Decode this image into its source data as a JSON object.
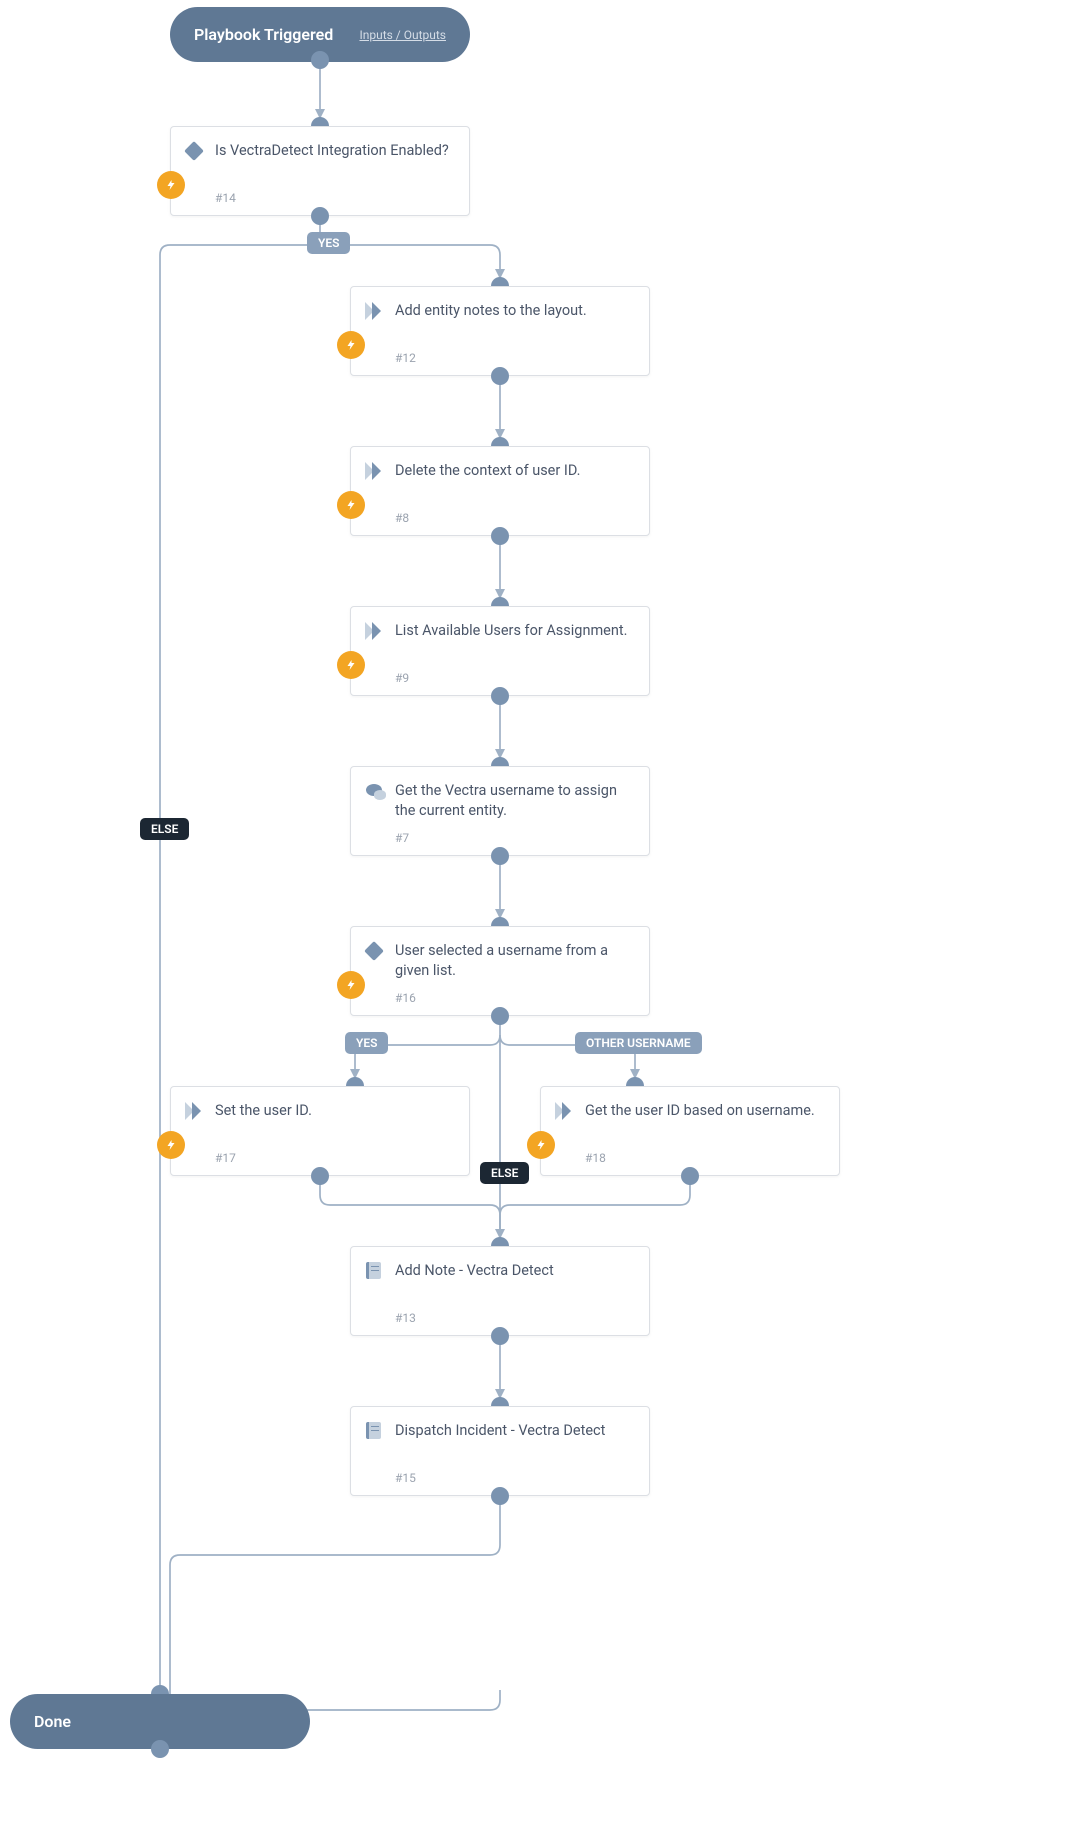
{
  "colors": {
    "pill": "#5f7894",
    "card_border": "#dcdfe4",
    "icon_primary": "#7a93b0",
    "icon_secondary": "#c5d1de",
    "bolt": "#f3a523",
    "branch_blue": "#8aa0ba",
    "branch_dark": "#1c2733",
    "connector": "#9fb1c5"
  },
  "start": {
    "title": "Playbook Triggered",
    "io_link": "Inputs / Outputs"
  },
  "end": {
    "title": "Done"
  },
  "branch_labels": {
    "yes": "YES",
    "else": "ELSE",
    "other_username": "OTHER USERNAME"
  },
  "cards": {
    "n14": {
      "title": "Is VectraDetect Integration Enabled?",
      "id": "#14",
      "icon": "diamond",
      "bolt": true
    },
    "n12": {
      "title": "Add entity notes to the layout.",
      "id": "#12",
      "icon": "chip",
      "bolt": true
    },
    "n8": {
      "title": "Delete the context of user ID.",
      "id": "#8",
      "icon": "chip",
      "bolt": true
    },
    "n9": {
      "title": "List Available Users for Assignment.",
      "id": "#9",
      "icon": "chip",
      "bolt": true
    },
    "n7": {
      "title": "Get the Vectra username to assign the current entity.",
      "id": "#7",
      "icon": "chat",
      "bolt": false
    },
    "n16": {
      "title": "User selected a username from a given list.",
      "id": "#16",
      "icon": "diamond",
      "bolt": true
    },
    "n17": {
      "title": "Set the user ID.",
      "id": "#17",
      "icon": "chip",
      "bolt": true
    },
    "n18": {
      "title": "Get the user ID based on username.",
      "id": "#18",
      "icon": "chip",
      "bolt": true
    },
    "n13": {
      "title": "Add Note - Vectra Detect",
      "id": "#13",
      "icon": "book",
      "bolt": false
    },
    "n15": {
      "title": "Dispatch Incident - Vectra Detect",
      "id": "#15",
      "icon": "book",
      "bolt": false
    }
  },
  "flow": {
    "start_out": [
      "n14"
    ],
    "n14": {
      "YES": "n12",
      "ELSE": "end"
    },
    "n12": {
      "next": "n8"
    },
    "n8": {
      "next": "n9"
    },
    "n9": {
      "next": "n7"
    },
    "n7": {
      "next": "n16"
    },
    "n16": {
      "YES": "n17",
      "OTHER USERNAME": "n18",
      "ELSE": "n13"
    },
    "n17": {
      "next": "n13"
    },
    "n18": {
      "next": "n13"
    },
    "n13": {
      "next": "n15"
    },
    "n15": {
      "next": "end"
    }
  }
}
